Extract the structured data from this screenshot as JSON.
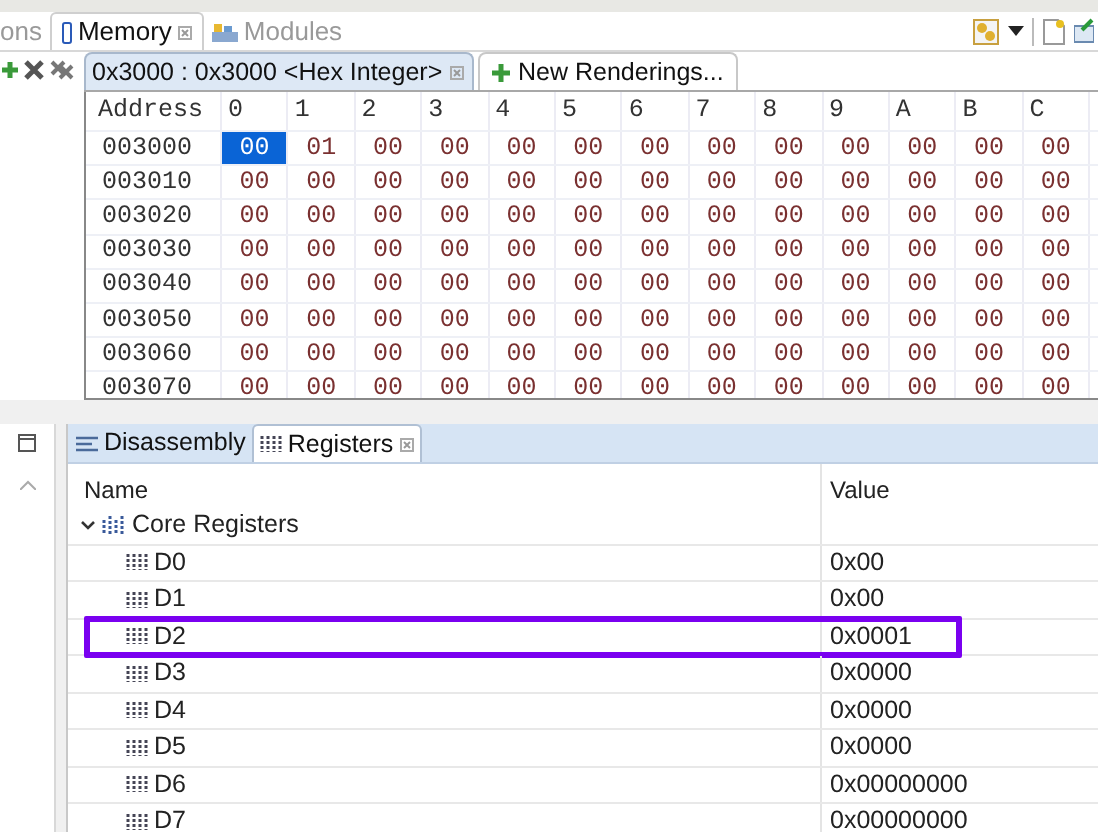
{
  "memory_view": {
    "tabs": [
      {
        "label": "ons",
        "selected": false,
        "kind": "plain"
      },
      {
        "label": "Memory",
        "selected": true,
        "kind": "memory"
      },
      {
        "label": "Modules",
        "selected": false,
        "kind": "modules"
      }
    ],
    "renderings": [
      {
        "label": "0x3000 : 0x3000 <Hex Integer>",
        "selected": true,
        "kind": "rendering"
      },
      {
        "label": "New Renderings...",
        "selected": false,
        "kind": "new"
      }
    ],
    "columns": [
      "Address",
      "0",
      "1",
      "2",
      "3",
      "4",
      "5",
      "6",
      "7",
      "8",
      "9",
      "A",
      "B",
      "C"
    ],
    "rows": [
      {
        "address": "003000",
        "cells": [
          {
            "value": "00",
            "selected": true
          },
          {
            "value": "01",
            "selected": false
          },
          {
            "value": "00",
            "selected": false
          },
          {
            "value": "00",
            "selected": false
          },
          {
            "value": "00",
            "selected": false
          },
          {
            "value": "00",
            "selected": false
          },
          {
            "value": "00",
            "selected": false
          },
          {
            "value": "00",
            "selected": false
          },
          {
            "value": "00",
            "selected": false
          },
          {
            "value": "00",
            "selected": false
          },
          {
            "value": "00",
            "selected": false
          },
          {
            "value": "00",
            "selected": false
          },
          {
            "value": "00",
            "selected": false
          }
        ]
      },
      {
        "address": "003010",
        "cells": [
          {
            "value": "00",
            "selected": false
          },
          {
            "value": "00",
            "selected": false
          },
          {
            "value": "00",
            "selected": false
          },
          {
            "value": "00",
            "selected": false
          },
          {
            "value": "00",
            "selected": false
          },
          {
            "value": "00",
            "selected": false
          },
          {
            "value": "00",
            "selected": false
          },
          {
            "value": "00",
            "selected": false
          },
          {
            "value": "00",
            "selected": false
          },
          {
            "value": "00",
            "selected": false
          },
          {
            "value": "00",
            "selected": false
          },
          {
            "value": "00",
            "selected": false
          },
          {
            "value": "00",
            "selected": false
          }
        ]
      },
      {
        "address": "003020",
        "cells": [
          {
            "value": "00",
            "selected": false
          },
          {
            "value": "00",
            "selected": false
          },
          {
            "value": "00",
            "selected": false
          },
          {
            "value": "00",
            "selected": false
          },
          {
            "value": "00",
            "selected": false
          },
          {
            "value": "00",
            "selected": false
          },
          {
            "value": "00",
            "selected": false
          },
          {
            "value": "00",
            "selected": false
          },
          {
            "value": "00",
            "selected": false
          },
          {
            "value": "00",
            "selected": false
          },
          {
            "value": "00",
            "selected": false
          },
          {
            "value": "00",
            "selected": false
          },
          {
            "value": "00",
            "selected": false
          }
        ]
      },
      {
        "address": "003030",
        "cells": [
          {
            "value": "00",
            "selected": false
          },
          {
            "value": "00",
            "selected": false
          },
          {
            "value": "00",
            "selected": false
          },
          {
            "value": "00",
            "selected": false
          },
          {
            "value": "00",
            "selected": false
          },
          {
            "value": "00",
            "selected": false
          },
          {
            "value": "00",
            "selected": false
          },
          {
            "value": "00",
            "selected": false
          },
          {
            "value": "00",
            "selected": false
          },
          {
            "value": "00",
            "selected": false
          },
          {
            "value": "00",
            "selected": false
          },
          {
            "value": "00",
            "selected": false
          },
          {
            "value": "00",
            "selected": false
          }
        ]
      },
      {
        "address": "003040",
        "cells": [
          {
            "value": "00",
            "selected": false
          },
          {
            "value": "00",
            "selected": false
          },
          {
            "value": "00",
            "selected": false
          },
          {
            "value": "00",
            "selected": false
          },
          {
            "value": "00",
            "selected": false
          },
          {
            "value": "00",
            "selected": false
          },
          {
            "value": "00",
            "selected": false
          },
          {
            "value": "00",
            "selected": false
          },
          {
            "value": "00",
            "selected": false
          },
          {
            "value": "00",
            "selected": false
          },
          {
            "value": "00",
            "selected": false
          },
          {
            "value": "00",
            "selected": false
          },
          {
            "value": "00",
            "selected": false
          }
        ]
      },
      {
        "address": "003050",
        "cells": [
          {
            "value": "00",
            "selected": false
          },
          {
            "value": "00",
            "selected": false
          },
          {
            "value": "00",
            "selected": false
          },
          {
            "value": "00",
            "selected": false
          },
          {
            "value": "00",
            "selected": false
          },
          {
            "value": "00",
            "selected": false
          },
          {
            "value": "00",
            "selected": false
          },
          {
            "value": "00",
            "selected": false
          },
          {
            "value": "00",
            "selected": false
          },
          {
            "value": "00",
            "selected": false
          },
          {
            "value": "00",
            "selected": false
          },
          {
            "value": "00",
            "selected": false
          },
          {
            "value": "00",
            "selected": false
          }
        ]
      },
      {
        "address": "003060",
        "cells": [
          {
            "value": "00",
            "selected": false
          },
          {
            "value": "00",
            "selected": false
          },
          {
            "value": "00",
            "selected": false
          },
          {
            "value": "00",
            "selected": false
          },
          {
            "value": "00",
            "selected": false
          },
          {
            "value": "00",
            "selected": false
          },
          {
            "value": "00",
            "selected": false
          },
          {
            "value": "00",
            "selected": false
          },
          {
            "value": "00",
            "selected": false
          },
          {
            "value": "00",
            "selected": false
          },
          {
            "value": "00",
            "selected": false
          },
          {
            "value": "00",
            "selected": false
          },
          {
            "value": "00",
            "selected": false
          }
        ]
      },
      {
        "address": "003070",
        "cells": [
          {
            "value": "00",
            "selected": false
          },
          {
            "value": "00",
            "selected": false
          },
          {
            "value": "00",
            "selected": false
          },
          {
            "value": "00",
            "selected": false
          },
          {
            "value": "00",
            "selected": false
          },
          {
            "value": "00",
            "selected": false
          },
          {
            "value": "00",
            "selected": false
          },
          {
            "value": "00",
            "selected": false
          },
          {
            "value": "00",
            "selected": false
          },
          {
            "value": "00",
            "selected": false
          },
          {
            "value": "00",
            "selected": false
          },
          {
            "value": "00",
            "selected": false
          },
          {
            "value": "00",
            "selected": false
          }
        ]
      }
    ]
  },
  "registers_view": {
    "tabs": [
      {
        "label": "Disassembly",
        "selected": false,
        "kind": "disassembly"
      },
      {
        "label": "Registers",
        "selected": true,
        "kind": "registers"
      }
    ],
    "columns": [
      "Name",
      "Value"
    ],
    "groups": [
      {
        "name": "Core Registers",
        "expanded": true,
        "children": [
          {
            "name": "D0",
            "value": "0x00",
            "highlighted": false
          },
          {
            "name": "D1",
            "value": "0x00",
            "highlighted": false
          },
          {
            "name": "D2",
            "value": "0x0001",
            "highlighted": true
          },
          {
            "name": "D3",
            "value": "0x0000",
            "highlighted": false
          },
          {
            "name": "D4",
            "value": "0x0000",
            "highlighted": false
          },
          {
            "name": "D5",
            "value": "0x0000",
            "highlighted": false
          },
          {
            "name": "D6",
            "value": "0x00000000",
            "highlighted": false
          },
          {
            "name": "D7",
            "value": "0x00000000",
            "highlighted": false
          }
        ]
      }
    ]
  }
}
